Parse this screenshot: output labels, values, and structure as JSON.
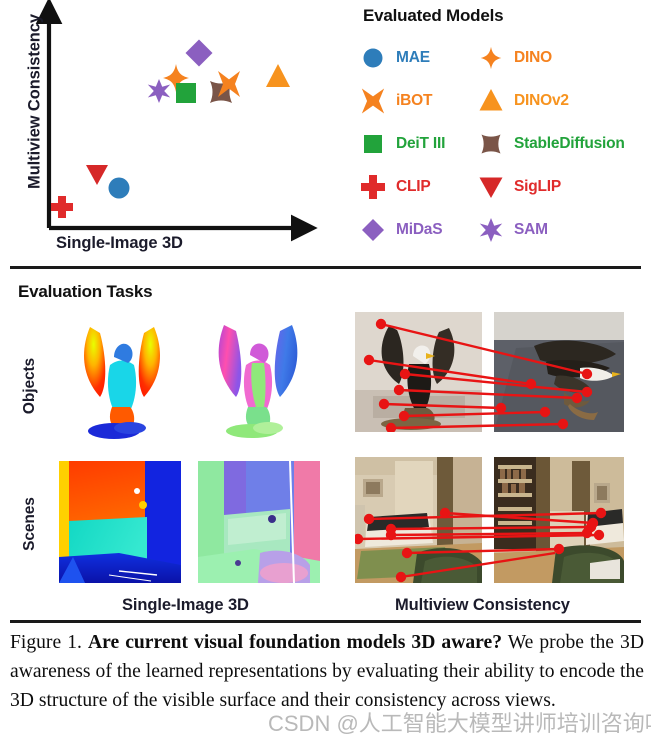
{
  "plot": {
    "y_axis_label": "Multiview Consistency",
    "x_axis_label": "Single-Image 3D"
  },
  "legend": {
    "title": "Evaluated Models",
    "entries": [
      {
        "label": "MAE",
        "marker": "circle",
        "color": "#2E7DBA"
      },
      {
        "label": "DINO",
        "marker": "four-point-star",
        "color": "#F5821F"
      },
      {
        "label": "iBOT",
        "marker": "cross-x",
        "color": "#F5821F"
      },
      {
        "label": "DINOv2",
        "marker": "triangle-up",
        "color": "#F7931E"
      },
      {
        "label": "DeiT III",
        "marker": "square",
        "color": "#22A33B"
      },
      {
        "label": "StableDiffusion",
        "marker": "concave-square",
        "color": "#7A5548"
      },
      {
        "label": "CLIP",
        "marker": "plus",
        "color": "#E02B2B"
      },
      {
        "label": "SigLIP",
        "marker": "triangle-down",
        "color": "#E02B2B"
      },
      {
        "label": "MiDaS",
        "marker": "diamond",
        "color": "#8B5FC0"
      },
      {
        "label": "SAM",
        "marker": "six-point-star",
        "color": "#8B5FC0"
      }
    ]
  },
  "chart_data": {
    "type": "scatter",
    "title": "",
    "xlabel": "Single-Image 3D",
    "ylabel": "Multiview Consistency",
    "xlim": [
      0,
      1
    ],
    "ylim": [
      0,
      1
    ],
    "grid": false,
    "axes_style": "arrow-axes-no-ticks",
    "legend_position": "right",
    "note": "Qualitative scatter: axis values are unlabeled; x/y are normalized positions read off the plot box.",
    "points": [
      {
        "label": "CLIP",
        "x": 0.045,
        "y": 0.105,
        "marker": "plus",
        "color": "#E02B2B"
      },
      {
        "label": "SigLIP",
        "x": 0.175,
        "y": 0.255,
        "marker": "triangle-down",
        "color": "#E02B2B"
      },
      {
        "label": "MAE",
        "x": 0.275,
        "y": 0.2,
        "marker": "circle",
        "color": "#2E7DBA"
      },
      {
        "label": "SAM",
        "x": 0.495,
        "y": 0.63,
        "marker": "six-point-star",
        "color": "#8B5FC0"
      },
      {
        "label": "DINO",
        "x": 0.57,
        "y": 0.69,
        "marker": "four-point-star",
        "color": "#F5821F"
      },
      {
        "label": "DeiT III",
        "x": 0.6,
        "y": 0.62,
        "marker": "square",
        "color": "#22A33B"
      },
      {
        "label": "MiDaS",
        "x": 0.655,
        "y": 0.8,
        "marker": "diamond",
        "color": "#8B5FC0"
      },
      {
        "label": "StableDiffusion",
        "x": 0.755,
        "y": 0.625,
        "marker": "concave-square",
        "color": "#7A5548"
      },
      {
        "label": "iBOT",
        "x": 0.785,
        "y": 0.665,
        "marker": "cross-x",
        "color": "#F5821F"
      },
      {
        "label": "DINOv2",
        "x": 0.925,
        "y": 0.705,
        "marker": "triangle-up",
        "color": "#F7931E"
      }
    ]
  },
  "tasks": {
    "title": "Evaluation Tasks",
    "row_labels": {
      "objects": "Objects",
      "scenes": "Scenes"
    },
    "column_captions": {
      "single_image_3d": "Single-Image 3D",
      "multiview_consistency": "Multiview Consistency"
    },
    "thumbnails": [
      {
        "name": "objects-depth",
        "content": "eagle statue depth map (rainbow colormap)"
      },
      {
        "name": "objects-normals",
        "content": "eagle statue surface normal map"
      },
      {
        "name": "objects-corr-left",
        "content": "eagle statue photo, view 1 with keypoints"
      },
      {
        "name": "objects-corr-right",
        "content": "eagle statue photo, view 2 with keypoints"
      },
      {
        "name": "scenes-depth",
        "content": "indoor scene depth map (rainbow colormap)"
      },
      {
        "name": "scenes-normals",
        "content": "indoor scene surface normal map"
      },
      {
        "name": "scenes-corr-left",
        "content": "bedroom photo, view 1 with keypoints"
      },
      {
        "name": "scenes-corr-right",
        "content": "bedroom photo, view 2 with keypoints"
      }
    ],
    "correspondence_line_color": "#E81414"
  },
  "caption": {
    "figure_number": "Figure 1.",
    "bold_question": "Are current visual foundation models 3D aware?",
    "body": " We probe the 3D awareness of the learned representations by evaluating their ability to encode the 3D structure of the visible surface and their consistency across views."
  },
  "watermark": {
    "text": "CSDN @人工智能大模型讲师培训咨询叶梓"
  }
}
